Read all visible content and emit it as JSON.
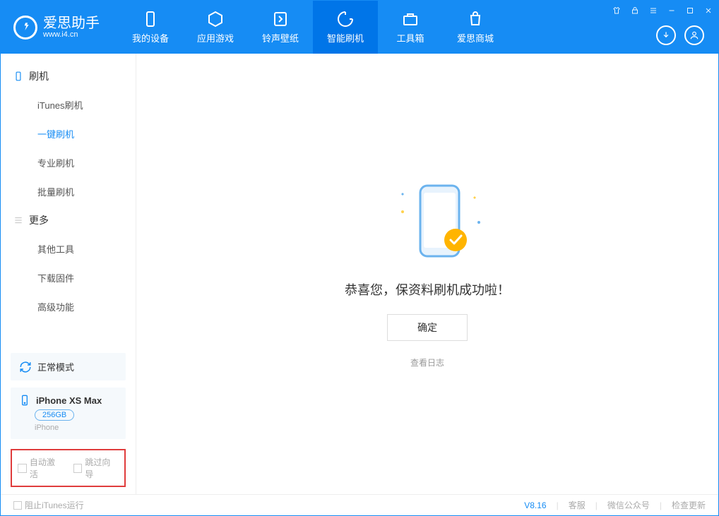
{
  "app": {
    "title": "爱思助手",
    "subtitle": "www.i4.cn"
  },
  "tabs": {
    "device": "我的设备",
    "apps": "应用游戏",
    "ringtone": "铃声壁纸",
    "flash": "智能刷机",
    "toolbox": "工具箱",
    "store": "爱思商城"
  },
  "sidebar": {
    "group_flash": "刷机",
    "itunes_flash": "iTunes刷机",
    "one_click_flash": "一键刷机",
    "pro_flash": "专业刷机",
    "batch_flash": "批量刷机",
    "group_more": "更多",
    "other_tools": "其他工具",
    "download_fw": "下载固件",
    "advanced": "高级功能"
  },
  "mode": {
    "label": "正常模式"
  },
  "device": {
    "name": "iPhone XS Max",
    "storage": "256GB",
    "type": "iPhone"
  },
  "options": {
    "auto_activate": "自动激活",
    "skip_guide": "跳过向导"
  },
  "main": {
    "success": "恭喜您，保资料刷机成功啦！",
    "ok": "确定",
    "view_log": "查看日志"
  },
  "footer": {
    "block_itunes": "阻止iTunes运行",
    "version": "V8.16",
    "support": "客服",
    "wechat": "微信公众号",
    "update": "检查更新"
  }
}
